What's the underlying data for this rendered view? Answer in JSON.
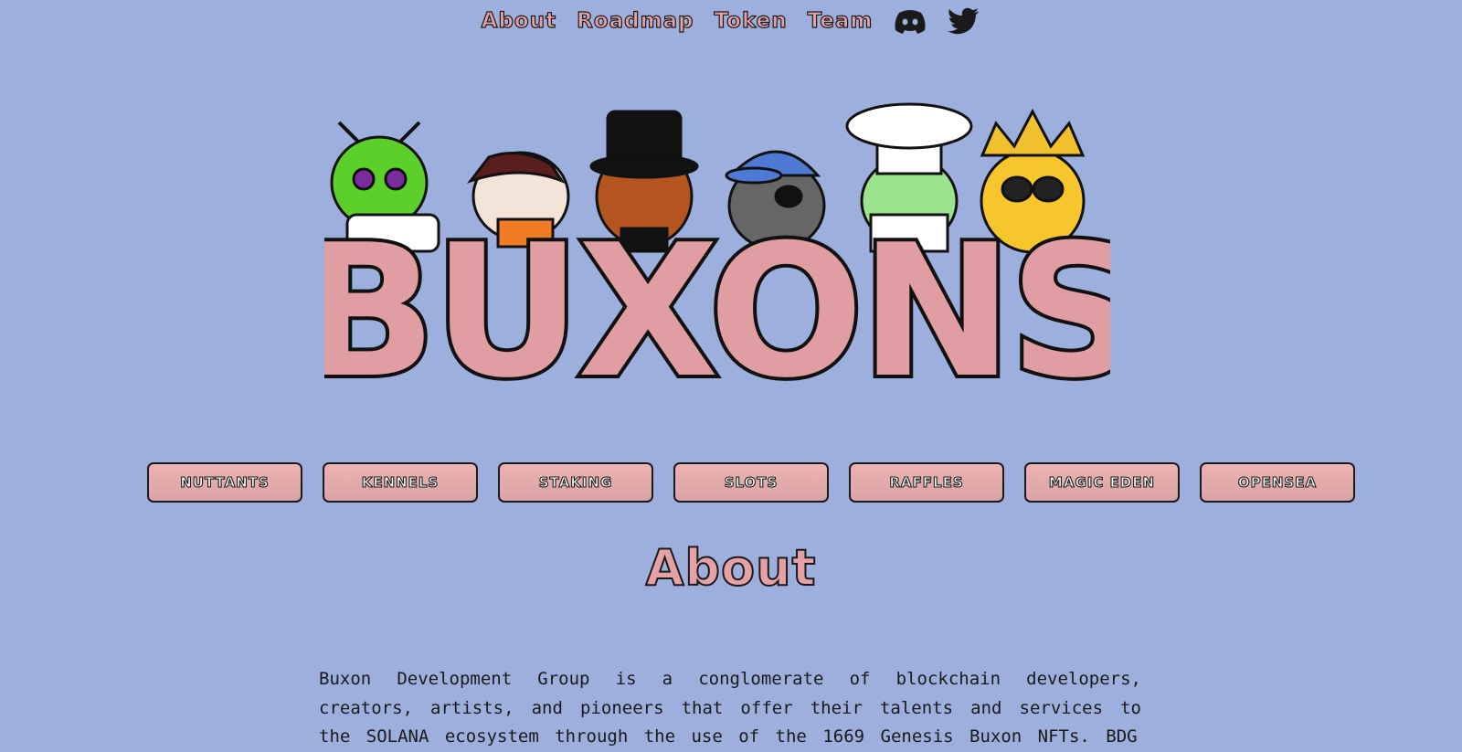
{
  "nav": {
    "links": [
      "About",
      "Roadmap",
      "Token",
      "Team"
    ],
    "icons": [
      "discord-icon",
      "twitter-icon"
    ]
  },
  "logo": {
    "text": "BUXONS"
  },
  "buttons": [
    "NUTTANTS",
    "KENNELS",
    "STAKING",
    "SLOTS",
    "RAFFLES",
    "MAGIC EDEN",
    "OPENSEA"
  ],
  "about": {
    "heading": "About",
    "paragraph": "Buxon Development Group is a conglomerate of blockchain developers, creators, artists, and pioneers that offer their talents and services to the SOLANA ecosystem through the use of the 1669 Genesis Buxon NFTs. BDG"
  },
  "colors": {
    "background": "#9db0dd",
    "accent_pink": "#e6a1a5",
    "outline": "#1a1a1a"
  }
}
